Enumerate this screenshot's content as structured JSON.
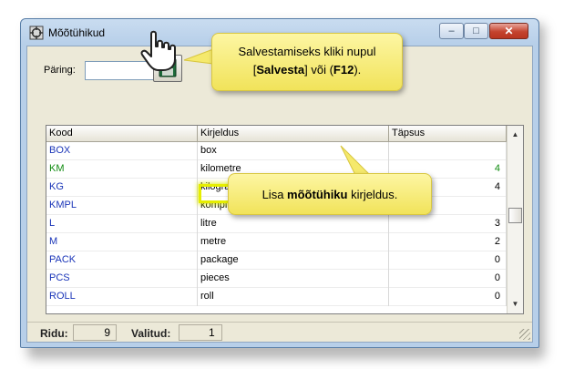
{
  "window": {
    "title": "Mõõtühikud"
  },
  "title_buttons": {
    "minimize": "–",
    "maximize": "□",
    "close": "✕"
  },
  "query": {
    "label": "Päring:",
    "value": ""
  },
  "table": {
    "columns": [
      "Kood",
      "Kirjeldus",
      "Täpsus"
    ],
    "rows": [
      {
        "code": "BOX",
        "description": "box",
        "precision": ""
      },
      {
        "code": "KM",
        "description": "kilometre",
        "precision": "4"
      },
      {
        "code": "KG",
        "description": "kilogram",
        "precision": "4"
      },
      {
        "code": "KMPL",
        "description": "kompl",
        "precision": ""
      },
      {
        "code": "L",
        "description": "litre",
        "precision": "3"
      },
      {
        "code": "M",
        "description": "metre",
        "precision": "2"
      },
      {
        "code": "PACK",
        "description": "package",
        "precision": "0"
      },
      {
        "code": "PCS",
        "description": "pieces",
        "precision": "0"
      },
      {
        "code": "ROLL",
        "description": "roll",
        "precision": "0"
      }
    ],
    "selected_row": 1
  },
  "status": {
    "rows_label": "Ridu:",
    "rows_value": "9",
    "selected_label": "Valitud:",
    "selected_value": "1"
  },
  "callouts": {
    "save_line1": "Salvestamiseks kliki nupul",
    "save_line2_pre": "[",
    "save_line2_bold1": "Salvesta",
    "save_line2_mid": "] või (",
    "save_line2_bold2": "F12",
    "save_line2_post": ").",
    "desc_pre": "Lisa ",
    "desc_bold": "mõõtühiku",
    "desc_post": " kirjeldus."
  },
  "icons": {
    "app": "units-app-icon",
    "save": "floppy-disk-icon",
    "cursor": "hand-pointer-icon"
  },
  "colors": {
    "code_text": "#1a35b8",
    "selected_text": "#118c11",
    "callout_fill": "#f5e96c",
    "highlight": "#e6ee00"
  }
}
